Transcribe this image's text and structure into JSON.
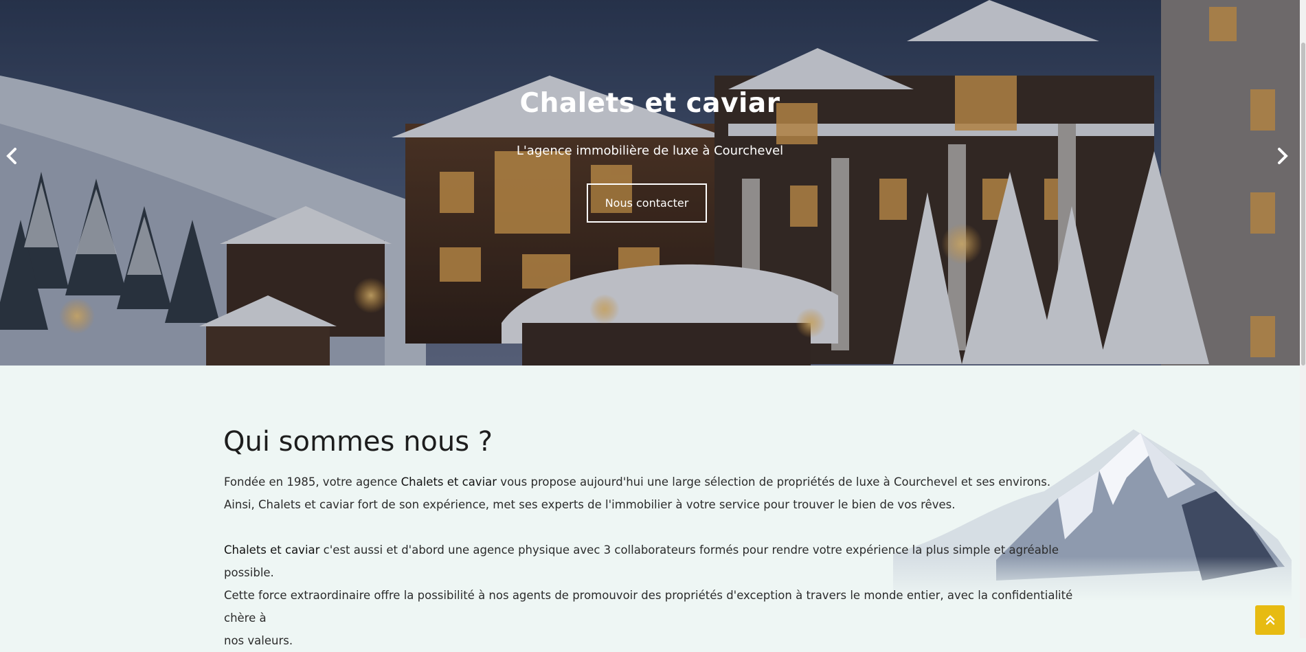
{
  "hero": {
    "title": "Chalets et caviar",
    "subtitle": "L'agence immobilière de luxe à Courchevel",
    "cta_label": "Nous contacter",
    "prev_icon": "chevron-left-icon",
    "next_icon": "chevron-right-icon"
  },
  "about": {
    "title": "Qui sommes nous ?",
    "p1_a": "Fondée en 1985, votre agence ",
    "p1_brand": "Chalets et caviar",
    "p1_b": " vous propose aujourd'hui une large sélection de propriétés de luxe à Courchevel et ses environs.",
    "p1_line2": "Ainsi, Chalets et caviar fort de son expérience, met ses experts de l'immobilier à votre service pour trouver le bien de vos rêves.",
    "p2_brand": "Chalets et caviar",
    "p2_a": " c'est aussi et d'abord une agence physique avec 3 collaborateurs formés pour rendre votre expérience la plus simple et agréable possible.",
    "p2_line2": "Cette force extraordinaire offre la possibilité à nos agents de promouvoir des propriétés d'exception à travers le monde entier, avec la confidentialité chère à",
    "p2_line3": "nos valeurs."
  },
  "back_to_top_icon": "double-chevron-up-icon",
  "colors": {
    "background": "#eef6f4",
    "accent": "#e7bb12",
    "hero_text": "#ffffff"
  }
}
